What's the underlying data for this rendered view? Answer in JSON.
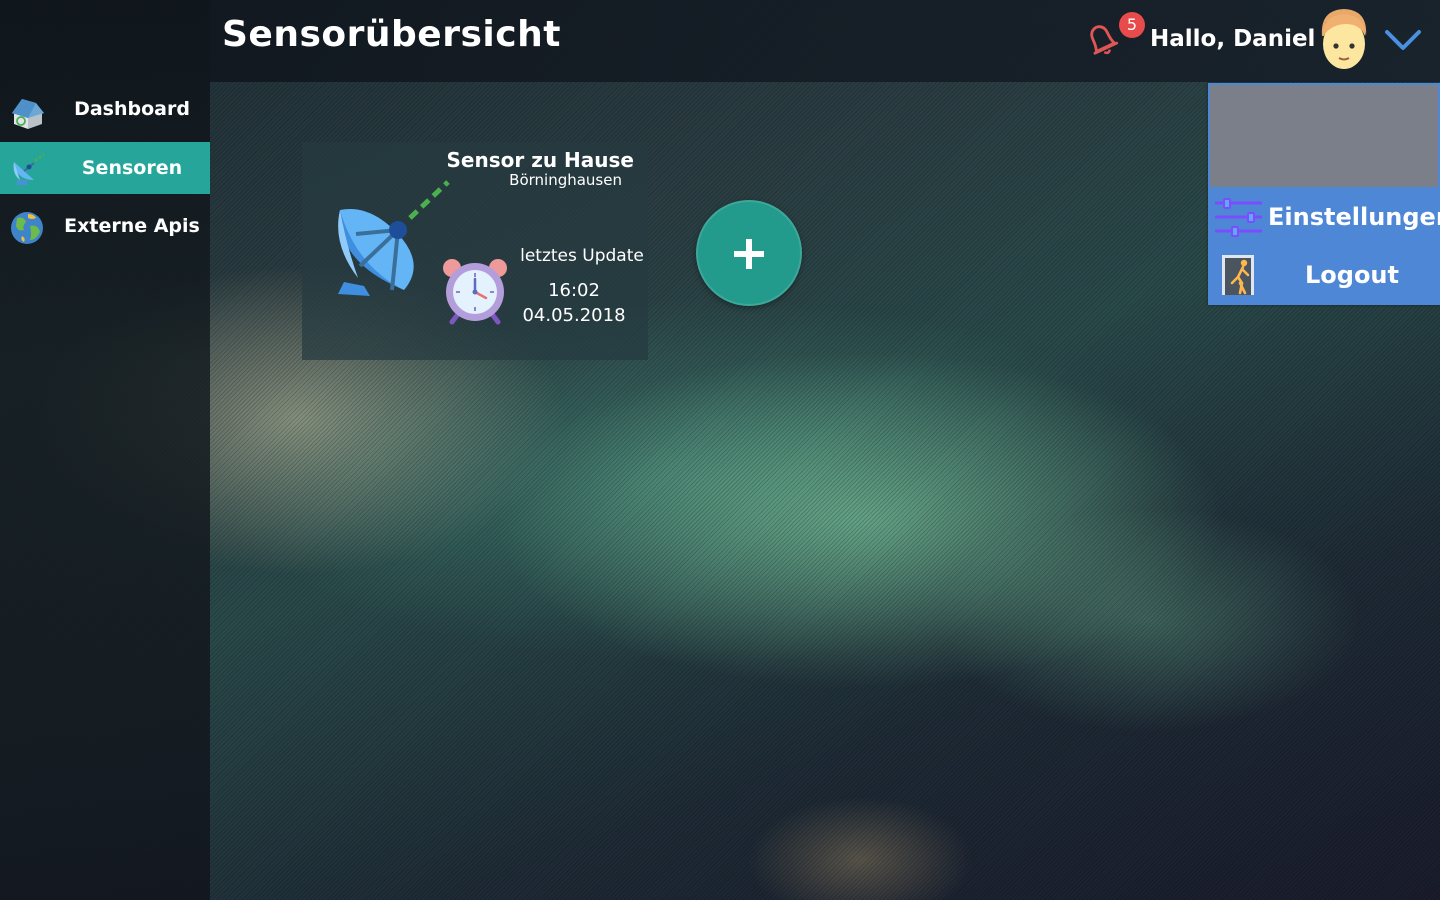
{
  "header": {
    "title": "Sensorübersicht",
    "notification_count": "5",
    "greeting": "Hallo, Daniel",
    "icons": {
      "bell": "bell-icon",
      "avatar": "user-avatar",
      "chevron": "chevron-down-icon"
    }
  },
  "sidebar": {
    "active_color": "#26a69a",
    "items": [
      {
        "label": "Dashboard",
        "icon": "house-icon",
        "active": false
      },
      {
        "label": "Sensoren",
        "icon": "satellite-dish-icon",
        "active": true
      },
      {
        "label": "Externe Apis",
        "icon": "globe-icon",
        "active": false
      }
    ]
  },
  "sensor_card": {
    "title": "Sensor zu Hause",
    "location": "Börninghausen",
    "update_label": "letztes Update",
    "update_time": "16:02",
    "update_date": "04.05.2018",
    "icons": {
      "sensor": "satellite-dish-icon",
      "clock": "alarm-clock-icon"
    }
  },
  "add_button": {
    "icon": "plus-icon",
    "color": "#239b8c"
  },
  "user_menu": {
    "color": "#4e87d6",
    "items": [
      {
        "label": "Einstellungen",
        "icon": "sliders-icon"
      },
      {
        "label": "Logout",
        "icon": "exit-door-icon"
      }
    ]
  }
}
